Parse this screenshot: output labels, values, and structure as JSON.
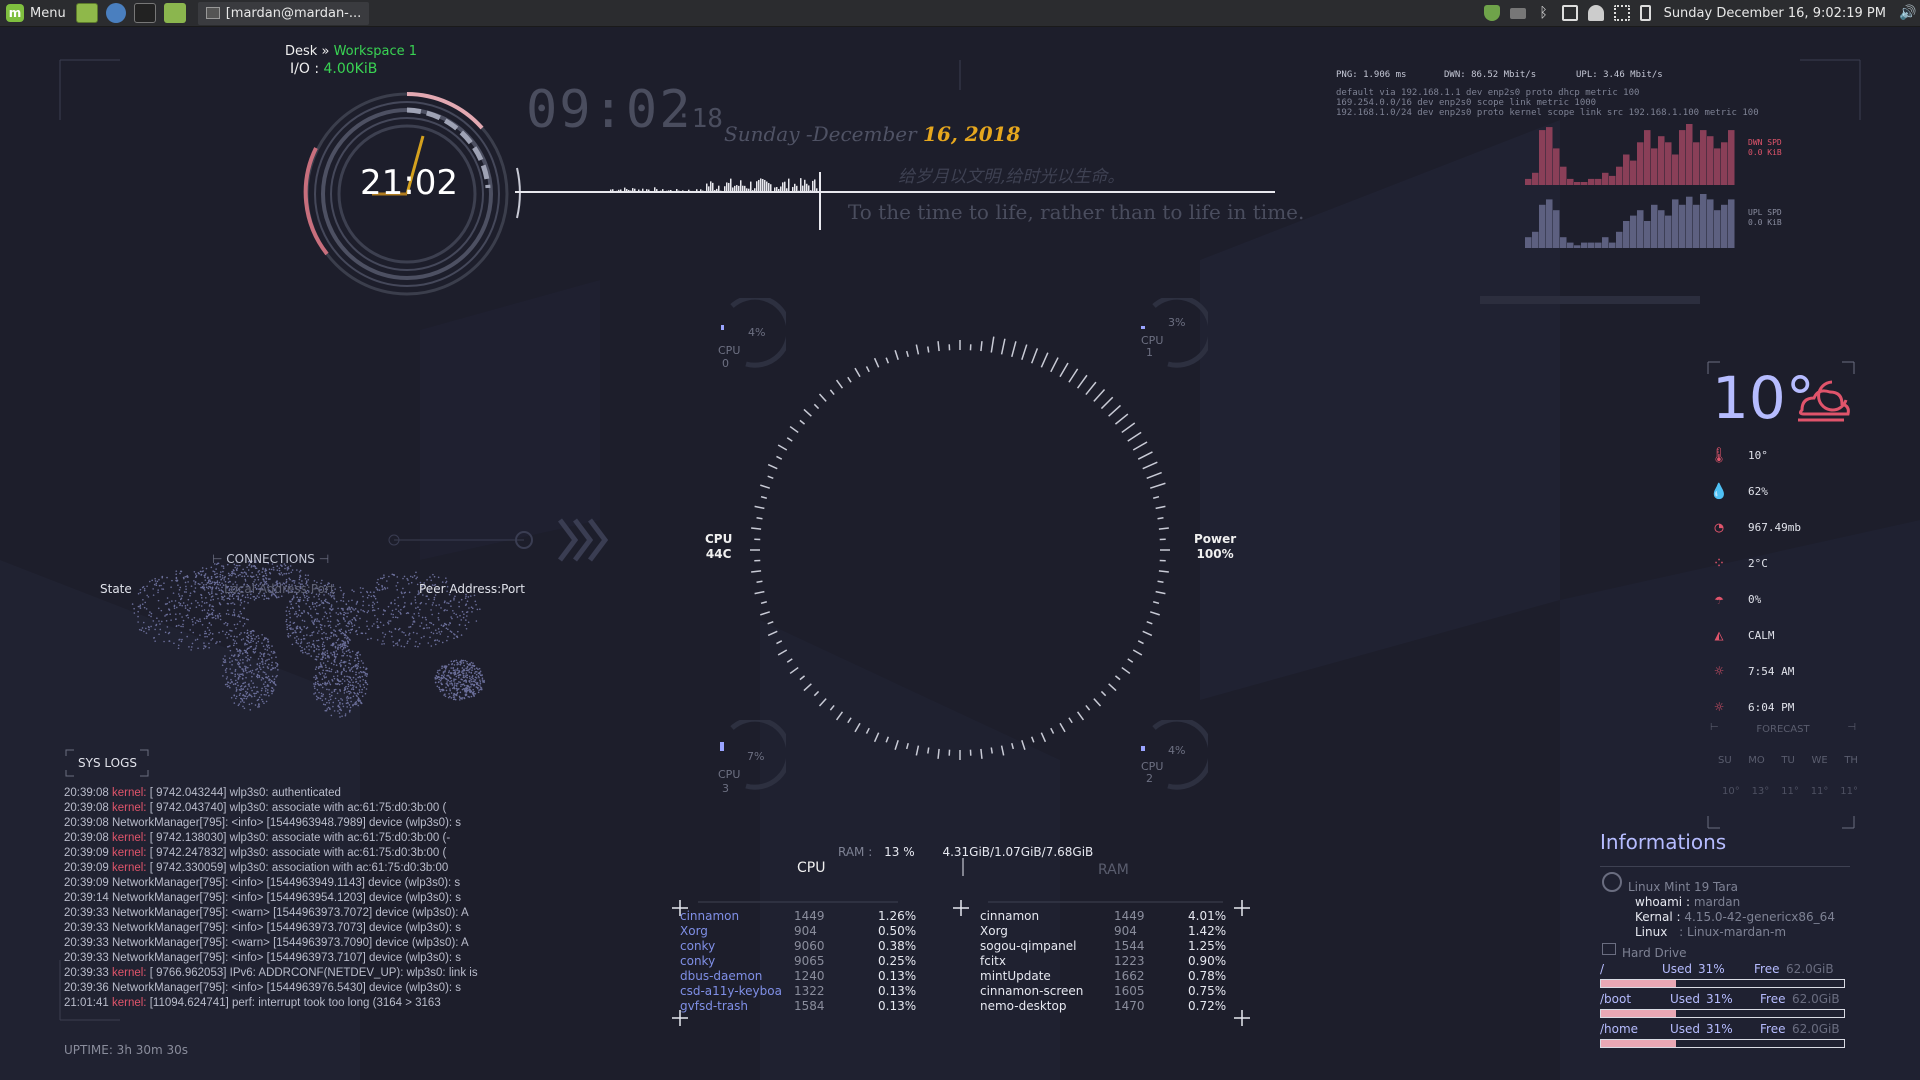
{
  "panel": {
    "menu_label": "Menu",
    "task_title": "[mardan@mardan-...",
    "clock": "Sunday December 16, 9:02:19 PM"
  },
  "desk": {
    "desk_label": "Desk",
    "sep": "»",
    "workspace": "Workspace 1",
    "io_label": "I/O :",
    "io_value": "4.00KiB"
  },
  "clock": {
    "ring_time": "21:02",
    "big_time": "09:02",
    "big_seconds": ":18",
    "date_prefix": "Sunday -December",
    "date_day_year": "16, 2018",
    "quote_cn": "给岁月以文明,给时光以生命。",
    "quote_en": "To the time to life, rather than to life in time."
  },
  "network": {
    "png": "PNG: 1.906 ms",
    "dwn": "DWN: 86.52 Mbit/s",
    "upl": "UPL: 3.46 Mbit/s",
    "routes": [
      "default via 192.168.1.1 dev enp2s0 proto dhcp metric 100",
      "169.254.0.0/16 dev enp2s0 scope link metric 1000",
      "192.168.1.0/24 dev enp2s0 proto kernel scope link src 192.168.1.100 metric 100"
    ],
    "dwn_spd_label": "DWN SPD",
    "dwn_spd_value": "0.0 KiB",
    "upl_spd_label": "UPL SPD",
    "upl_spd_value": "0.0 KiB",
    "dwn_bars": [
      0.1,
      0.2,
      0.9,
      0.95,
      0.6,
      0.3,
      0.1,
      0.05,
      0.05,
      0.1,
      0.1,
      0.2,
      0.15,
      0.3,
      0.5,
      0.4,
      0.7,
      0.9,
      0.6,
      0.8,
      0.7,
      0.5,
      0.9,
      1.0,
      0.7,
      0.9,
      0.8,
      0.6,
      0.7,
      0.9
    ],
    "upl_bars": [
      0.2,
      0.3,
      0.8,
      0.9,
      0.7,
      0.2,
      0.1,
      0.05,
      0.1,
      0.1,
      0.1,
      0.2,
      0.1,
      0.3,
      0.5,
      0.6,
      0.7,
      0.5,
      0.8,
      0.7,
      0.6,
      0.9,
      0.8,
      0.95,
      0.8,
      1.0,
      0.9,
      0.7,
      0.8,
      0.9
    ]
  },
  "cpus": [
    {
      "label": "CPU",
      "num": "0",
      "pct": "4%"
    },
    {
      "label": "CPU",
      "num": "1",
      "pct": "3%"
    },
    {
      "label": "CPU",
      "num": "3",
      "pct": "7%"
    },
    {
      "label": "CPU",
      "num": "2",
      "pct": "4%"
    }
  ],
  "center": {
    "cpu_temp_label": "CPU",
    "cpu_temp": "44C",
    "power_label": "Power",
    "power_value": "100%"
  },
  "weather": {
    "temp": "10°",
    "rows": [
      {
        "icon": "thermometer-icon",
        "glyph": "🌡",
        "value": "10°"
      },
      {
        "icon": "humidity-icon",
        "glyph": "💧",
        "value": "62%"
      },
      {
        "icon": "pressure-icon",
        "glyph": "◔",
        "value": "967.49mb"
      },
      {
        "icon": "dewpoint-icon",
        "glyph": "⁘",
        "value": "2°C"
      },
      {
        "icon": "umbrella-icon",
        "glyph": "☂",
        "value": "0%"
      },
      {
        "icon": "wind-icon",
        "glyph": "◭",
        "value": "CALM"
      },
      {
        "icon": "sunrise-icon",
        "glyph": "☼",
        "value": "7:54 AM"
      },
      {
        "icon": "sunset-icon",
        "glyph": "☼",
        "value": "6:04 PM"
      }
    ],
    "forecast_label": "FORECAST",
    "forecast_days": [
      "SU",
      "MO",
      "TU",
      "WE",
      "TH"
    ],
    "forecast_temps": [
      "10°",
      "13°",
      "11°",
      "11°",
      "11°"
    ]
  },
  "connections": {
    "title": "CONNECTIONS",
    "state": "State",
    "local": "Local Address:Port",
    "peer": "Peer Address:Port"
  },
  "syslogs": {
    "title": "SYS LOGS",
    "lines": [
      {
        "time": "20:39:08",
        "src": "kernel:",
        "msg": "[ 9742.043244] wlp3s0: authenticated",
        "kernel": true
      },
      {
        "time": "20:39:08",
        "src": "kernel:",
        "msg": "[ 9742.043740] wlp3s0: associate with ac:61:75:d0:3b:00 (",
        "kernel": true
      },
      {
        "time": "20:39:08",
        "src": "NetworkManager[795]:",
        "msg": "<info> [1544963948.7989] device (wlp3s0): s",
        "kernel": false
      },
      {
        "time": "20:39:08",
        "src": "kernel:",
        "msg": "[ 9742.138030] wlp3s0: associate with ac:61:75:d0:3b:00 (-",
        "kernel": true
      },
      {
        "time": "20:39:09",
        "src": "kernel:",
        "msg": "[ 9742.247832] wlp3s0: associate with ac:61:75:d0:3b:00 (",
        "kernel": true
      },
      {
        "time": "20:39:09",
        "src": "kernel:",
        "msg": "[ 9742.330059] wlp3s0: association with ac:61:75:d0:3b:00",
        "kernel": true
      },
      {
        "time": "20:39:09",
        "src": "NetworkManager[795]:",
        "msg": "<info> [1544963949.1143] device (wlp3s0): s",
        "kernel": false
      },
      {
        "time": "20:39:14",
        "src": "NetworkManager[795]:",
        "msg": "<info> [1544963954.1203] device (wlp3s0): s",
        "kernel": false
      },
      {
        "time": "20:39:33",
        "src": "NetworkManager[795]:",
        "msg": "<warn> [1544963973.7072] device (wlp3s0): A",
        "kernel": false
      },
      {
        "time": "20:39:33",
        "src": "NetworkManager[795]:",
        "msg": "<info> [1544963973.7073] device (wlp3s0): s",
        "kernel": false
      },
      {
        "time": "20:39:33",
        "src": "NetworkManager[795]:",
        "msg": "<warn> [1544963973.7090] device (wlp3s0): A",
        "kernel": false
      },
      {
        "time": "20:39:33",
        "src": "NetworkManager[795]:",
        "msg": "<info> [1544963973.7107] device (wlp3s0): s",
        "kernel": false
      },
      {
        "time": "20:39:33",
        "src": "kernel:",
        "msg": "[ 9766.962053] IPv6: ADDRCONF(NETDEV_UP): wlp3s0: link is",
        "kernel": true
      },
      {
        "time": "20:39:36",
        "src": "NetworkManager[795]:",
        "msg": "<info> [1544963976.5430] device (wlp3s0): s",
        "kernel": false
      },
      {
        "time": "21:01:41",
        "src": "kernel:",
        "msg": "[11094.624741] perf: interrupt took too long (3164 > 3163",
        "kernel": true
      }
    ],
    "uptime": "UPTIME: 3h 30m 30s"
  },
  "ram_summary": {
    "label": "RAM :",
    "pct": "13 %",
    "values": "4.31GiB/1.07GiB/7.68GiB"
  },
  "cpu_procs": {
    "title": "CPU",
    "rows": [
      {
        "name": "cinnamon",
        "pid": "1449",
        "pct": "1.26%"
      },
      {
        "name": "Xorg",
        "pid": "904",
        "pct": "0.50%"
      },
      {
        "name": "conky",
        "pid": "9060",
        "pct": "0.38%"
      },
      {
        "name": "conky",
        "pid": "9065",
        "pct": "0.25%"
      },
      {
        "name": "dbus-daemon",
        "pid": "1240",
        "pct": "0.13%"
      },
      {
        "name": "csd-a11y-keyboa",
        "pid": "1322",
        "pct": "0.13%"
      },
      {
        "name": "gvfsd-trash",
        "pid": "1584",
        "pct": "0.13%"
      }
    ]
  },
  "ram_procs": {
    "title": "RAM",
    "rows": [
      {
        "name": "cinnamon",
        "pid": "1449",
        "pct": "4.01%"
      },
      {
        "name": "Xorg",
        "pid": "904",
        "pct": "1.42%"
      },
      {
        "name": "sogou-qimpanel",
        "pid": "1544",
        "pct": "1.25%"
      },
      {
        "name": "fcitx",
        "pid": "1223",
        "pct": "0.90%"
      },
      {
        "name": "mintUpdate",
        "pid": "1662",
        "pct": "0.78%"
      },
      {
        "name": "cinnamon-screen",
        "pid": "1605",
        "pct": "0.75%"
      },
      {
        "name": "nemo-desktop",
        "pid": "1470",
        "pct": "0.72%"
      }
    ]
  },
  "info": {
    "title": "Informations",
    "os": "Linux Mint 19 Tara",
    "whoami_label": "whoami :",
    "whoami": "mardan",
    "kernel_label": "Kernal :",
    "kernel": "4.15.0-42-genericx86_64",
    "linux_label": "Linux",
    "linux": ": Linux-mardan-m",
    "hd_label": "Hard Drive",
    "disks": [
      {
        "mount": "/",
        "used_label": "Used",
        "used": "31%",
        "free_label": "Free",
        "free": "62.0GiB",
        "fill": 0.31
      },
      {
        "mount": "/boot",
        "used_label": "Used",
        "used": "31%",
        "free_label": "Free",
        "free": "62.0GiB",
        "fill": 0.31
      },
      {
        "mount": "/home",
        "used_label": "Used",
        "used": "31%",
        "free_label": "Free",
        "free": "62.0GiB",
        "fill": 0.31
      }
    ]
  },
  "colors": {
    "background": "#1d1e2b",
    "accent_red": "#e0546b",
    "accent_green": "#39d353",
    "accent_gold": "#e6a71e",
    "proc_blue": "#7f8fe6"
  }
}
